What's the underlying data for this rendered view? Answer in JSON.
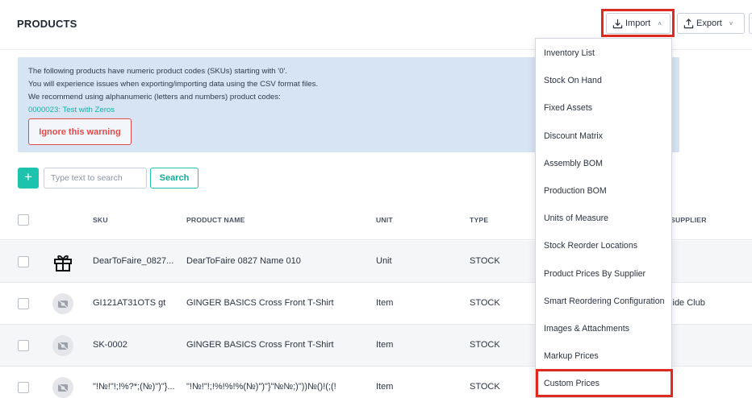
{
  "header": {
    "title": "PRODUCTS",
    "import_label": "Import",
    "export_label": "Export"
  },
  "warning": {
    "lines": [
      "The following products have numeric product codes (SKUs) starting with '0'.",
      "You will experience issues when exporting/importing data using the CSV format files.",
      "We recommend using alphanumeric (letters and numbers) product codes:"
    ],
    "link": "0000023: Test with Zeros",
    "ignore_label": "Ignore this warning"
  },
  "toolbar": {
    "add_label": "+",
    "search_placeholder": "Type text to search",
    "search_label": "Search"
  },
  "table": {
    "columns": {
      "sku": "SKU",
      "name": "PRODUCT NAME",
      "unit": "UNIT",
      "type": "TYPE",
      "supplier": "T SUPPLIER"
    },
    "rows": [
      {
        "sku": "DearToFaire_0827...",
        "name": "DearToFaire 0827 Name 010",
        "unit": "Unit",
        "type": "STOCK",
        "supplier": "",
        "thumb": "gift-icon"
      },
      {
        "sku": "GI121AT31OTS gt",
        "name": "GINGER BASICS Cross Front T-Shirt",
        "unit": "Item",
        "type": "STOCK",
        "supplier": "side Club",
        "thumb": "no-image-icon"
      },
      {
        "sku": "SK-0002",
        "name": "GINGER BASICS Cross Front T-Shirt",
        "unit": "Item",
        "type": "STOCK",
        "supplier": "",
        "thumb": "no-image-icon"
      },
      {
        "sku": "\"!№!\"!;!%?*;(№)\")\"}...",
        "name": "\"!№!\"!;!%!%!%(№)\")\"}\"№№;)\"))№()!(;(!",
        "unit": "Item",
        "type": "STOCK",
        "supplier": "",
        "thumb": "no-image-icon"
      }
    ]
  },
  "import_menu": {
    "items": [
      "Inventory List",
      "Stock On Hand",
      "Fixed Assets",
      "Discount Matrix",
      "Assembly BOM",
      "Production BOM",
      "Units of Measure",
      "Stock Reorder Locations",
      "Product Prices By Supplier",
      "Smart Reordering Configuration",
      "Images & Attachments",
      "Markup Prices",
      "Custom Prices"
    ],
    "highlighted": "Custom Prices"
  },
  "colors": {
    "accent": "#1ec3ae",
    "highlight": "#e02a1f",
    "warning_bg": "#d7e4f4",
    "danger": "#e24a4a"
  }
}
